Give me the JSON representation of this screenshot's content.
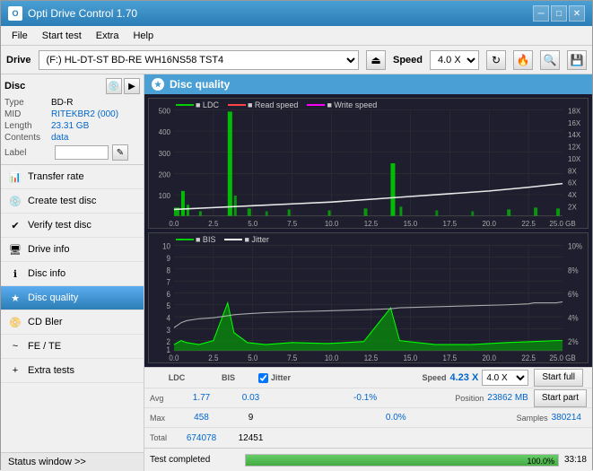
{
  "titleBar": {
    "title": "Opti Drive Control 1.70",
    "minimizeBtn": "─",
    "maximizeBtn": "□",
    "closeBtn": "✕"
  },
  "menuBar": {
    "items": [
      "File",
      "Start test",
      "Extra",
      "Help"
    ]
  },
  "driveBar": {
    "driveLabel": "Drive",
    "driveValue": "(F:) HL-DT-ST BD-RE  WH16NS58 TST4",
    "speedLabel": "Speed",
    "speedValue": "4.0 X"
  },
  "disc": {
    "title": "Disc",
    "typeLabel": "Type",
    "typeValue": "BD-R",
    "midLabel": "MID",
    "midValue": "RITEKBR2 (000)",
    "lengthLabel": "Length",
    "lengthValue": "23.31 GB",
    "contentsLabel": "Contents",
    "contentsValue": "data",
    "labelLabel": "Label",
    "labelValue": ""
  },
  "navItems": [
    {
      "label": "Transfer rate",
      "icon": "chart",
      "active": false
    },
    {
      "label": "Create test disc",
      "icon": "disc",
      "active": false
    },
    {
      "label": "Verify test disc",
      "icon": "verify",
      "active": false
    },
    {
      "label": "Drive info",
      "icon": "drive",
      "active": false
    },
    {
      "label": "Disc info",
      "icon": "info",
      "active": false
    },
    {
      "label": "Disc quality",
      "icon": "quality",
      "active": true
    },
    {
      "label": "CD Bler",
      "icon": "cd",
      "active": false
    },
    {
      "label": "FE / TE",
      "icon": "fe",
      "active": false
    },
    {
      "label": "Extra tests",
      "icon": "extra",
      "active": false
    }
  ],
  "statusWindowBtn": "Status window >>",
  "discQuality": {
    "title": "Disc quality",
    "chart1": {
      "legend": [
        {
          "color": "#00cc00",
          "label": "LDC"
        },
        {
          "color": "#ff4444",
          "label": "Read speed"
        },
        {
          "color": "#ff00ff",
          "label": "Write speed"
        }
      ],
      "yAxisLeft": [
        "500",
        "400",
        "300",
        "200",
        "100"
      ],
      "yAxisRight": [
        "18X",
        "16X",
        "14X",
        "12X",
        "10X",
        "8X",
        "6X",
        "4X",
        "2X"
      ],
      "xAxis": [
        "0.0",
        "2.5",
        "5.0",
        "7.5",
        "10.0",
        "12.5",
        "15.0",
        "17.5",
        "20.0",
        "22.5",
        "25.0 GB"
      ]
    },
    "chart2": {
      "legend": [
        {
          "color": "#00cc00",
          "label": "BIS"
        },
        {
          "color": "#ffffff",
          "label": "Jitter"
        }
      ],
      "yAxisLeft": [
        "10",
        "9",
        "8",
        "7",
        "6",
        "5",
        "4",
        "3",
        "2",
        "1"
      ],
      "yAxisRight": [
        "10%",
        "8%",
        "6%",
        "4%",
        "2%"
      ],
      "xAxis": [
        "0.0",
        "2.5",
        "5.0",
        "7.5",
        "10.0",
        "12.5",
        "15.0",
        "17.5",
        "20.0",
        "22.5",
        "25.0 GB"
      ]
    }
  },
  "stats": {
    "columns": [
      "LDC",
      "BIS",
      "",
      "Jitter",
      "Speed",
      ""
    ],
    "avgLabel": "Avg",
    "avgLDC": "1.77",
    "avgBIS": "0.03",
    "avgJitter": "-0.1%",
    "maxLabel": "Max",
    "maxLDC": "458",
    "maxBIS": "9",
    "maxJitter": "0.0%",
    "totalLabel": "Total",
    "totalLDC": "674078",
    "totalBIS": "12451",
    "jitterChecked": true,
    "jitterLabel": "Jitter",
    "speedLabel": "Speed",
    "speedValue": "4.23 X",
    "speedDropdown": "4.0 X",
    "positionLabel": "Position",
    "positionValue": "23862 MB",
    "samplesLabel": "Samples",
    "samplesValue": "380214",
    "startFullBtn": "Start full",
    "startPartBtn": "Start part"
  },
  "bottomBar": {
    "statusText": "Test completed",
    "progressValue": 100,
    "progressLabel": "100.0%",
    "timeValue": "33:18"
  }
}
